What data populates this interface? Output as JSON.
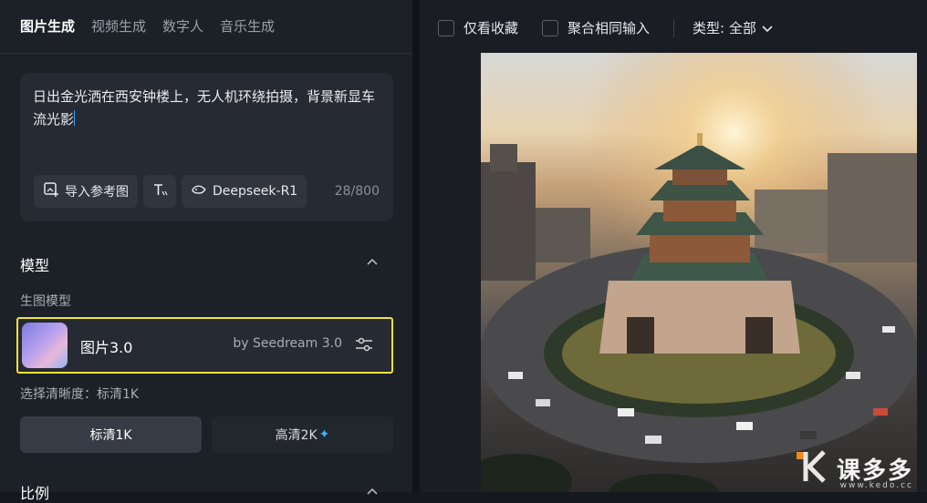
{
  "tabs": [
    "图片生成",
    "视频生成",
    "数字人",
    "音乐生成"
  ],
  "prompt": {
    "text": "日出金光洒在西安钟楼上，无人机环绕拍摄，背景新显车流光影",
    "import_ref_label": "导入参考图",
    "deepseek_label": "Deepseek-R1",
    "char_count": "28/800"
  },
  "model_section": {
    "title": "模型",
    "sub_label": "生图模型",
    "model_name": "图片3.0",
    "model_by": "by Seedream 3.0"
  },
  "resolution": {
    "label": "选择清晰度：标清1K",
    "option_sd": "标清1K",
    "option_hd": "高清2K"
  },
  "ratio_section": {
    "title": "比例"
  },
  "filters": {
    "favorites_label": "仅看收藏",
    "merge_label": "聚合相同输入",
    "type_label": "类型: 全部"
  },
  "watermark": {
    "text": "课多多",
    "domain": "www.kedo.cc"
  },
  "colors": {
    "highlight_border": "#f2e23a",
    "accent_blue": "#3bb4ff",
    "watermark_orange": "#f08a1c"
  }
}
